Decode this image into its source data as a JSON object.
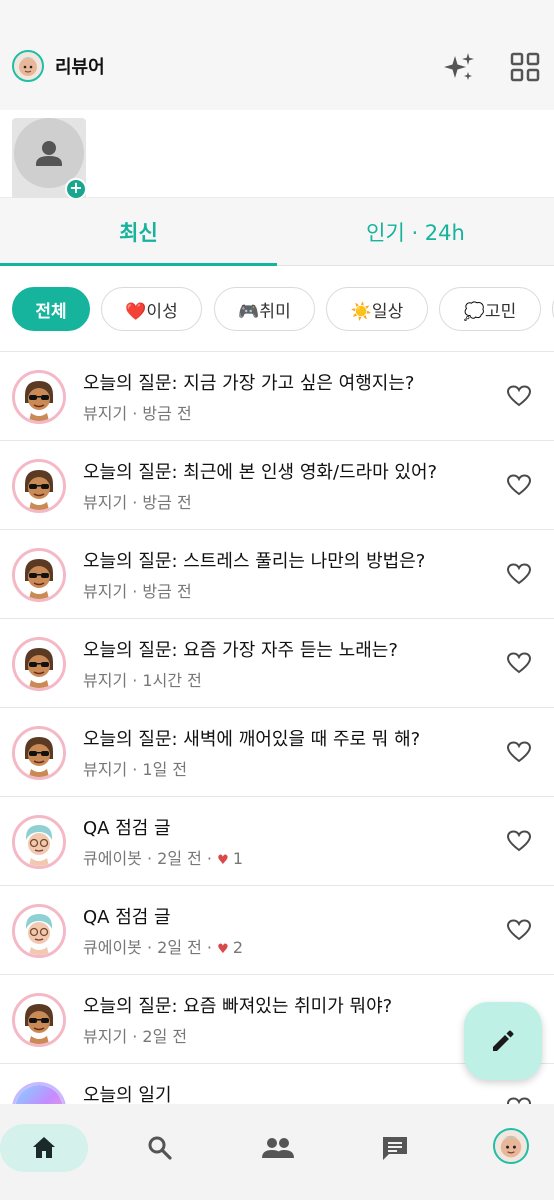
{
  "header": {
    "brand": "리뷰어"
  },
  "tabs": [
    {
      "label": "최신"
    },
    {
      "label": "인기 · 24h"
    }
  ],
  "chips": [
    {
      "label": "전체"
    },
    {
      "label": "❤️이성"
    },
    {
      "label": "🎮취미"
    },
    {
      "label": "☀️일상"
    },
    {
      "label": "💭고민"
    }
  ],
  "feed": [
    {
      "title": "오늘의 질문: 지금 가장 가고 싶은 여행지는?",
      "meta": "뷰지기 · 방금 전",
      "avatar": "sunglasses"
    },
    {
      "title": "오늘의 질문: 최근에 본 인생 영화/드라마 있어?",
      "meta": "뷰지기 · 방금 전",
      "avatar": "sunglasses"
    },
    {
      "title": "오늘의 질문: 스트레스 풀리는 나만의 방법은?",
      "meta": "뷰지기 · 방금 전",
      "avatar": "sunglasses"
    },
    {
      "title": "오늘의 질문: 요즘 가장 자주 듣는 노래는?",
      "meta": "뷰지기 · 1시간 전",
      "avatar": "sunglasses"
    },
    {
      "title": "오늘의 질문: 새벽에 깨어있을 때 주로 뭐 해?",
      "meta": "뷰지기 · 1일 전",
      "avatar": "sunglasses"
    },
    {
      "title": "QA 점검 글",
      "meta": "큐에이봇 · 2일 전 · ",
      "likes": "1",
      "avatar": "glasses"
    },
    {
      "title": "QA 점검 글",
      "meta": "큐에이봇 · 2일 전 · ",
      "likes": "2",
      "avatar": "glasses"
    },
    {
      "title": "오늘의 질문: 요즘 빠져있는 취미가 뭐야?",
      "meta": "뷰지기 · 2일 전",
      "avatar": "sunglasses"
    },
    {
      "title": "오늘의 일기",
      "meta": "",
      "avatar": "gradient"
    }
  ],
  "colors": {
    "accent": "#16b39d",
    "accent_light": "#d4f1ec",
    "fab": "#bff0e6",
    "like_red": "#d84a4a"
  },
  "icons": {
    "header": [
      "sparkle-icon",
      "grid-icon"
    ],
    "nav": [
      "home-icon",
      "search-icon",
      "people-icon",
      "chat-icon",
      "profile-avatar"
    ],
    "fab": "pencil-icon"
  }
}
